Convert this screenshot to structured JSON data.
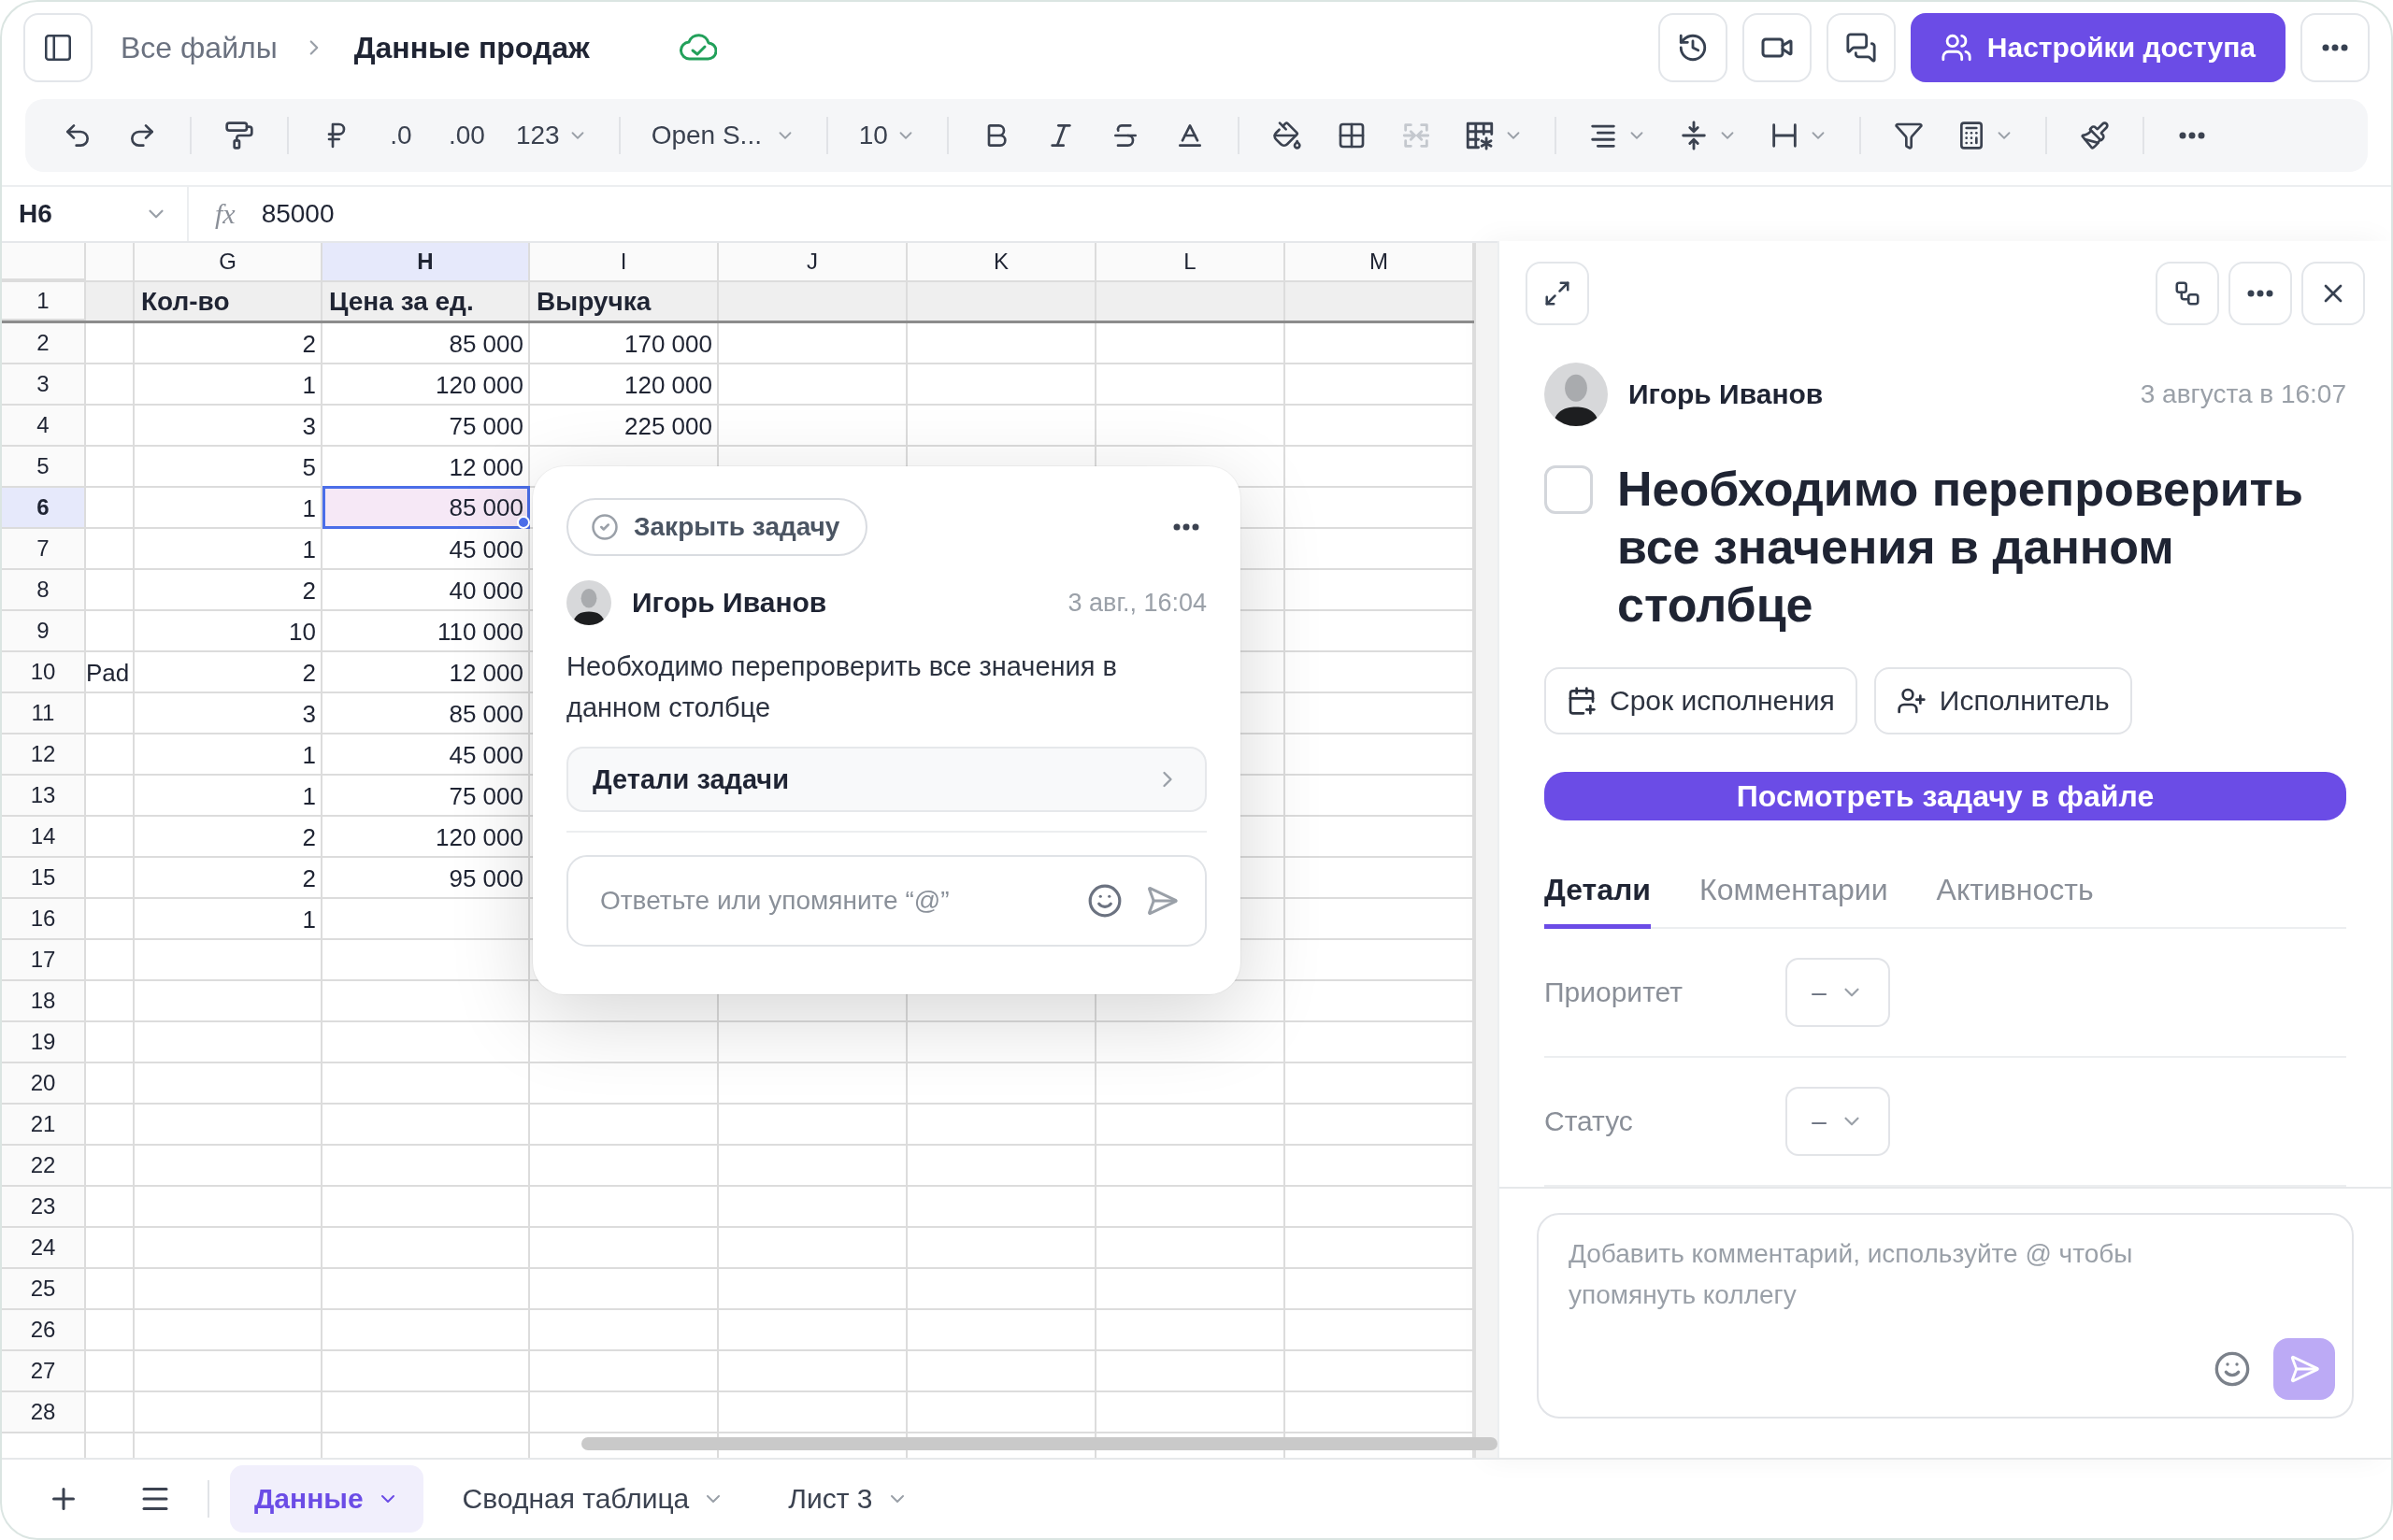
{
  "header": {
    "breadcrumb": "Все файлы",
    "title": "Данные продаж",
    "share_button": "Настройки доступа"
  },
  "toolbar": {
    "decimal_decrease": ".0",
    "decimal_increase": ".00",
    "number_format": "123",
    "font": "Open S...",
    "font_size": "10"
  },
  "formula_bar": {
    "cell": "H6",
    "fx": "fx",
    "value": "85000"
  },
  "grid": {
    "columns": [
      {
        "label": "G",
        "selected": false
      },
      {
        "label": "H",
        "selected": true
      },
      {
        "label": "I",
        "selected": false
      },
      {
        "label": "J",
        "selected": false
      },
      {
        "label": "K",
        "selected": false
      },
      {
        "label": "L",
        "selected": false
      },
      {
        "label": "M",
        "selected": false
      }
    ],
    "rows": [
      {
        "number": "1",
        "kind": "header",
        "selected": false,
        "cells": {
          "g": "Кол-во",
          "h": "Цена за ед.",
          "i": "Выручка"
        }
      },
      {
        "number": "2",
        "kind": "data",
        "selected": false,
        "cells": {
          "g": "2",
          "h": "85 000",
          "i": "170 000"
        }
      },
      {
        "number": "3",
        "kind": "data",
        "selected": false,
        "cells": {
          "g": "1",
          "h": "120 000",
          "i": "120 000"
        }
      },
      {
        "number": "4",
        "kind": "data",
        "selected": false,
        "cells": {
          "g": "3",
          "h": "75 000",
          "i": "225 000"
        }
      },
      {
        "number": "5",
        "kind": "data",
        "selected": false,
        "cells": {
          "g": "5",
          "h": "12 000"
        }
      },
      {
        "number": "6",
        "kind": "data",
        "selected": true,
        "cells": {
          "g": "1",
          "h": "85 000"
        }
      },
      {
        "number": "7",
        "kind": "data",
        "selected": false,
        "cells": {
          "g": "1",
          "h": "45 000"
        }
      },
      {
        "number": "8",
        "kind": "data",
        "selected": false,
        "cells": {
          "g": "2",
          "h": "40 000"
        }
      },
      {
        "number": "9",
        "kind": "data",
        "selected": false,
        "cells": {
          "g": "10",
          "h": "110 000"
        }
      },
      {
        "number": "10",
        "kind": "data",
        "selected": false,
        "cells": {
          "f": "Pad",
          "g": "2",
          "h": "12 000"
        }
      },
      {
        "number": "11",
        "kind": "data",
        "selected": false,
        "cells": {
          "g": "3",
          "h": "85 000"
        }
      },
      {
        "number": "12",
        "kind": "data",
        "selected": false,
        "cells": {
          "g": "1",
          "h": "45 000"
        }
      },
      {
        "number": "13",
        "kind": "data",
        "selected": false,
        "cells": {
          "g": "1",
          "h": "75 000"
        }
      },
      {
        "number": "14",
        "kind": "data",
        "selected": false,
        "cells": {
          "g": "2",
          "h": "120 000"
        }
      },
      {
        "number": "15",
        "kind": "data",
        "selected": false,
        "cells": {
          "g": "2",
          "h": "95 000"
        }
      },
      {
        "number": "16",
        "kind": "data",
        "selected": false,
        "cells": {
          "g": "1"
        }
      },
      {
        "number": "17",
        "kind": "data",
        "selected": false
      },
      {
        "number": "18",
        "kind": "data",
        "selected": false
      },
      {
        "number": "19",
        "kind": "data",
        "selected": false
      },
      {
        "number": "20",
        "kind": "data",
        "selected": false
      },
      {
        "number": "21",
        "kind": "data",
        "selected": false
      },
      {
        "number": "22",
        "kind": "data",
        "selected": false
      },
      {
        "number": "23",
        "kind": "data",
        "selected": false
      },
      {
        "number": "24",
        "kind": "data",
        "selected": false
      },
      {
        "number": "25",
        "kind": "data",
        "selected": false
      },
      {
        "number": "26",
        "kind": "data",
        "selected": false
      },
      {
        "number": "27",
        "kind": "data",
        "selected": false
      },
      {
        "number": "28",
        "kind": "data",
        "selected": false
      }
    ]
  },
  "task_popup": {
    "close_button": "Закрыть задачу",
    "author": "Игорь Иванов",
    "time": "3 авг., 16:04",
    "text": "Необходимо перепроверить все значения в данном столбце",
    "details_link": "Детали задачи",
    "reply": {
      "placeholder": "Ответьте или упомяните “@”"
    }
  },
  "task_panel": {
    "author": "Игорь Иванов",
    "time": "3 августа в 16:07",
    "done": false,
    "title": "Необходимо перепроверить все значения в данном столбце",
    "due_button": "Срок исполнения",
    "assignee_button": "Исполнитель",
    "open_button": "Посмотреть задачу в файле",
    "tabs": [
      {
        "label": "Детали",
        "selected": true
      },
      {
        "label": "Комментарии",
        "selected": false
      },
      {
        "label": "Активность",
        "selected": false
      }
    ],
    "fields": [
      {
        "label": "Приоритет",
        "value": "–"
      },
      {
        "label": "Статус",
        "value": "–"
      }
    ],
    "comment": {
      "placeholder": "Добавить комментарий, используйте @ чтобы упомянуть коллегу"
    }
  },
  "sheet_tabs": [
    {
      "label": "Данные",
      "selected": true
    },
    {
      "label": "Сводная таблица",
      "selected": false
    },
    {
      "label": "Лист 3",
      "selected": false
    }
  ]
}
